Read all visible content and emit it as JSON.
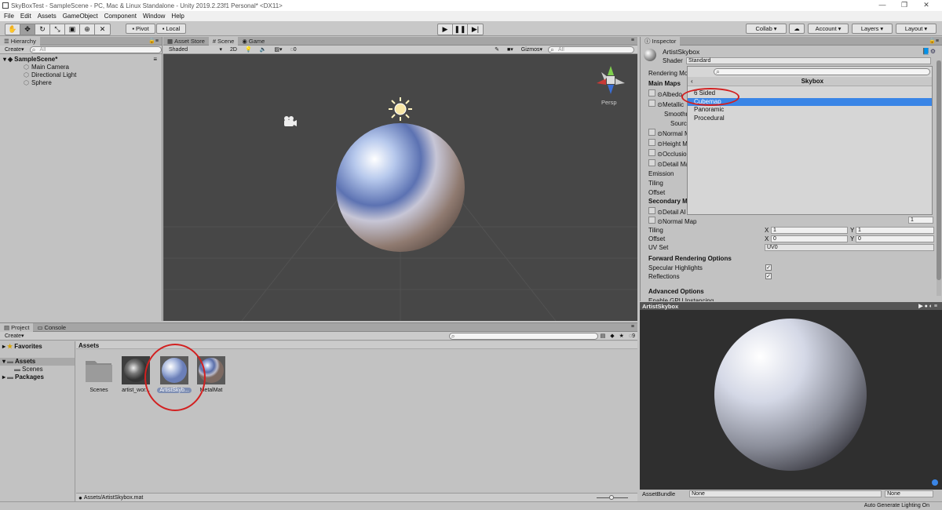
{
  "window": {
    "title": "SkyBoxTest - SampleScene - PC, Mac & Linux Standalone - Unity 2019.2.23f1 Personal* <DX11>"
  },
  "menu": [
    "File",
    "Edit",
    "Assets",
    "GameObject",
    "Component",
    "Window",
    "Help"
  ],
  "toolbar": {
    "pivot": "Pivot",
    "local": "Local",
    "collab": "Collab",
    "account": "Account",
    "layers": "Layers",
    "layout": "Layout"
  },
  "hierarchy": {
    "tab": "Hierarchy",
    "create": "Create",
    "search_placeholder": "All",
    "scene": "SampleScene*",
    "items": [
      "Main Camera",
      "Directional Light",
      "Sphere"
    ]
  },
  "scene_view": {
    "tabs": [
      "Asset Store",
      "Scene",
      "Game"
    ],
    "shading": "Shaded",
    "mode2d": "2D",
    "fx_count": "0",
    "gizmos": "Gizmos",
    "search_placeholder": "All",
    "persp": "Persp"
  },
  "project": {
    "tabs": [
      "Project",
      "Console"
    ],
    "create": "Create",
    "tree": [
      {
        "label": "Favorites",
        "bold": true
      },
      {
        "label": "Assets",
        "bold": true
      },
      {
        "label": "Scenes",
        "bold": false
      },
      {
        "label": "Packages",
        "bold": true
      }
    ],
    "header": "Assets",
    "assets": [
      {
        "label": "Scenes",
        "kind": "folder"
      },
      {
        "label": "artist_wor...",
        "kind": "tex"
      },
      {
        "label": "ArtistSkyb...",
        "kind": "mat-selected"
      },
      {
        "label": "MetalMat",
        "kind": "mat"
      }
    ],
    "hidden_count": "9",
    "status_path": "Assets/ArtistSkybox.mat"
  },
  "inspector": {
    "tab": "Inspector",
    "material_name": "ArtistSkybox",
    "shader_label": "Shader",
    "shader_value": "Standard",
    "rendering_mode": "Rendering Mo",
    "main_maps": "Main Maps",
    "rows": [
      "Albedo",
      "Metallic",
      "Smoothn",
      "Source",
      "Normal M",
      "Height M",
      "Occlusio",
      "Detail Ma",
      "Emission",
      "Tiling",
      "Offset"
    ],
    "secondary": "Secondary M",
    "detail_albedo": "Detail Al",
    "normal_map": "Normal Map",
    "normal_map_value": "1",
    "tiling": "Tiling",
    "offset": "Offset",
    "uv_set": "UV Set",
    "uv_value": "UV0",
    "x_label": "X",
    "y_label": "Y",
    "tiling_x": "1",
    "tiling_y": "1",
    "offset_x": "0",
    "offset_y": "0",
    "forward": "Forward Rendering Options",
    "specular": "Specular Highlights",
    "reflections": "Reflections",
    "advanced": "Advanced Options",
    "gpu": "Enable GPU Instancing"
  },
  "dropdown": {
    "title": "Skybox",
    "items": [
      "6 Sided",
      "Cubemap",
      "Panoramic",
      "Procedural"
    ],
    "selected_index": 1
  },
  "preview": {
    "title": "ArtistSkybox",
    "assetbundle_label": "AssetBundle",
    "bundle_value": "None",
    "variant_value": "None",
    "status": "Auto Generate Lighting On"
  },
  "colors": {
    "accent": "#3a85e6",
    "annotation": "#d22020"
  }
}
